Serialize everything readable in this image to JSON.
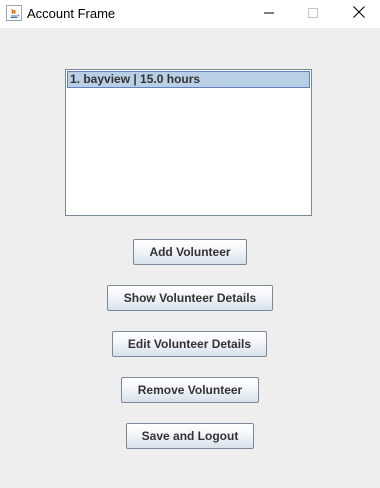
{
  "window": {
    "title": "Account Frame",
    "app_icon": "java-icon",
    "controls": [
      "minimize-icon",
      "maximize-icon",
      "close-icon"
    ]
  },
  "volunteer_list": {
    "items": [
      {
        "label": "1. bayview | 15.0 hours",
        "selected": true
      }
    ]
  },
  "buttons": {
    "add_volunteer": "Add Volunteer",
    "show_details": "Show Volunteer Details",
    "edit_details": "Edit Volunteer Details",
    "remove_volunteer": "Remove Volunteer",
    "save_logout": "Save and Logout"
  },
  "colors": {
    "selection_bg": "#b8cfe5",
    "selection_border": "#6382bf",
    "window_bg": "#eeeeee"
  }
}
